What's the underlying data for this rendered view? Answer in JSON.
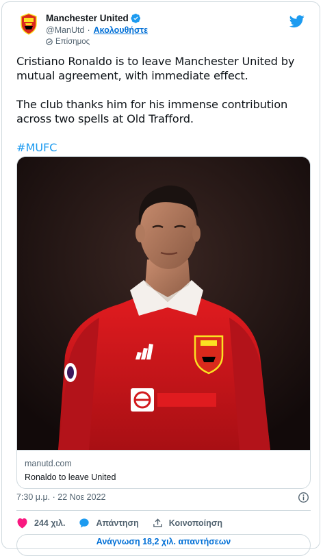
{
  "account": {
    "display_name": "Manchester United",
    "handle": "@ManUtd",
    "separator": "·",
    "follow_label": "Ακολουθήστε",
    "official_label": "Επίσημος",
    "verified": true
  },
  "tweet": {
    "paragraph_1": "Cristiano Ronaldo is to leave Manchester United by mutual agreement, with immediate effect.",
    "paragraph_2": "The club thanks him for his immense contribution across two spells at Old Trafford.",
    "hashtag": "#MUFC",
    "timestamp": "7:30 μ.μ. · 22 Νοε 2022"
  },
  "link_card": {
    "domain": "manutd.com",
    "title": "Ronaldo to leave United",
    "image_alt": "Cristiano Ronaldo in a red Manchester United shirt"
  },
  "actions": {
    "likes": "244 χιλ.",
    "reply_label": "Απάντηση",
    "share_label": "Κοινοποίηση",
    "read_replies_label": "Ανάγνωση 18,2 χιλ. απαντήσεων"
  },
  "colors": {
    "link_blue": "#006fd6",
    "hashtag_blue": "#1d9bf0",
    "like_pink": "#f91880",
    "twitter_blue": "#1d9bf0",
    "secondary_text": "#536471",
    "border": "#cfd9de"
  },
  "icons": [
    "club-crest-icon",
    "verified-badge-icon",
    "twitter-bird-icon",
    "official-label-icon",
    "info-icon",
    "heart-icon",
    "reply-bubble-icon",
    "share-icon"
  ]
}
